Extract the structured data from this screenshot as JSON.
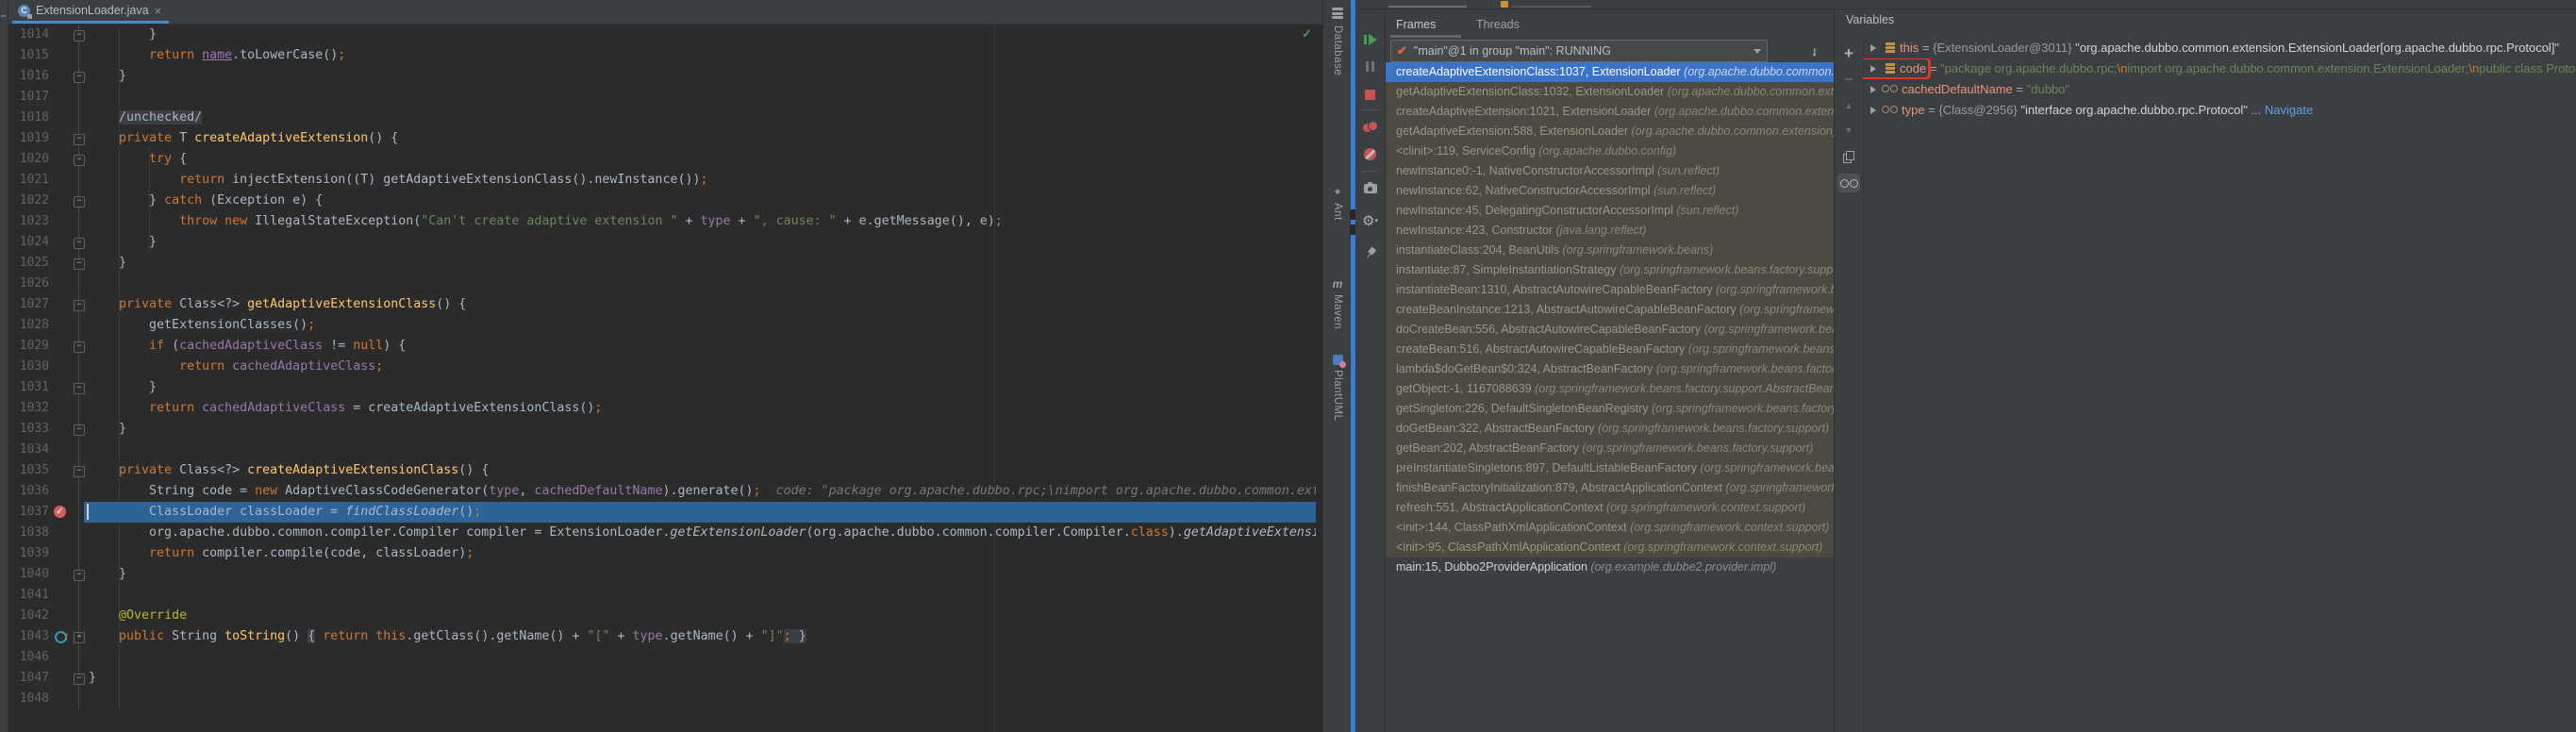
{
  "colors": {
    "editor_bg": "#2B2B2B",
    "panel_bg": "#3C3F41",
    "accent_tab_underline": "#4A88C7",
    "splitter_blue": "#3B7BD8",
    "exec_line_bg": "#2D6397",
    "selected_frame_bg": "#3B73C9",
    "library_frame_bg": "#4C4A41",
    "breakpoint_red": "#DB5C5C",
    "annotation_box_red": "#E3342B",
    "string_green": "#6A8759",
    "keyword_orange": "#CC7832",
    "field_purple": "#9876AA",
    "method_yellow": "#FFC66D",
    "link_blue": "#5F9EE8"
  },
  "editor": {
    "tab": {
      "title": "ExtensionLoader.java",
      "close_glyph": "×",
      "icon": "class-icon"
    },
    "inspection_status_glyph": "✓",
    "lines": [
      {
        "n": "1014",
        "g": "end",
        "t": [
          [
            "pl",
            "        }"
          ]
        ]
      },
      {
        "n": "1015",
        "t": [
          [
            "pl",
            "        "
          ],
          [
            "kw",
            "return"
          ],
          [
            "pl",
            " "
          ],
          [
            "fldu",
            "name"
          ],
          [
            "pl",
            ".toLowerCase()"
          ],
          [
            "sm",
            ";"
          ]
        ]
      },
      {
        "n": "1016",
        "g": "end",
        "t": [
          [
            "pl",
            "    }"
          ]
        ]
      },
      {
        "n": "1017",
        "t": []
      },
      {
        "n": "1018",
        "t": [
          [
            "pl",
            "    "
          ],
          [
            "fold",
            "/unchecked/"
          ]
        ]
      },
      {
        "n": "1019",
        "g": "open",
        "t": [
          [
            "pl",
            "    "
          ],
          [
            "kw",
            "private"
          ],
          [
            "pl",
            " T "
          ],
          [
            "fn",
            "createAdaptiveExtension"
          ],
          [
            "pl",
            "() {"
          ]
        ]
      },
      {
        "n": "1020",
        "g": "open",
        "t": [
          [
            "pl",
            "        "
          ],
          [
            "kw",
            "try"
          ],
          [
            "pl",
            " {"
          ]
        ]
      },
      {
        "n": "1021",
        "t": [
          [
            "pl",
            "            "
          ],
          [
            "kw",
            "return"
          ],
          [
            "pl",
            " injectExtension((T) getAdaptiveExtensionClass().newInstance())"
          ],
          [
            "sm",
            ";"
          ]
        ]
      },
      {
        "n": "1022",
        "g": "end",
        "t": [
          [
            "pl",
            "        } "
          ],
          [
            "kw",
            "catch"
          ],
          [
            "pl",
            " (Exception e) {"
          ]
        ]
      },
      {
        "n": "1023",
        "t": [
          [
            "pl",
            "            "
          ],
          [
            "kw",
            "throw"
          ],
          [
            "pl",
            " "
          ],
          [
            "kw",
            "new"
          ],
          [
            "pl",
            " IllegalStateException("
          ],
          [
            "st",
            "\"Can't create adaptive extension \""
          ],
          [
            "pl",
            " + "
          ],
          [
            "fld",
            "type"
          ],
          [
            "pl",
            " + "
          ],
          [
            "st",
            "\", cause: \""
          ],
          [
            "pl",
            " + e.getMessage(), e)"
          ],
          [
            "sm",
            ";"
          ]
        ]
      },
      {
        "n": "1024",
        "g": "end",
        "t": [
          [
            "pl",
            "        }"
          ]
        ]
      },
      {
        "n": "1025",
        "g": "end",
        "t": [
          [
            "pl",
            "    }"
          ]
        ]
      },
      {
        "n": "1026",
        "t": []
      },
      {
        "n": "1027",
        "g": "open",
        "t": [
          [
            "pl",
            "    "
          ],
          [
            "kw",
            "private"
          ],
          [
            "pl",
            " Class<?> "
          ],
          [
            "fn",
            "getAdaptiveExtensionClass"
          ],
          [
            "pl",
            "() {"
          ]
        ]
      },
      {
        "n": "1028",
        "t": [
          [
            "pl",
            "        getExtensionClasses()"
          ],
          [
            "sm",
            ";"
          ]
        ]
      },
      {
        "n": "1029",
        "g": "open",
        "t": [
          [
            "pl",
            "        "
          ],
          [
            "kw",
            "if"
          ],
          [
            "pl",
            " ("
          ],
          [
            "fld",
            "cachedAdaptiveClass"
          ],
          [
            "pl",
            " != "
          ],
          [
            "kw",
            "null"
          ],
          [
            "pl",
            ") {"
          ]
        ]
      },
      {
        "n": "1030",
        "t": [
          [
            "pl",
            "            "
          ],
          [
            "kw",
            "return"
          ],
          [
            "pl",
            " "
          ],
          [
            "fld",
            "cachedAdaptiveClass"
          ],
          [
            "sm",
            ";"
          ]
        ]
      },
      {
        "n": "1031",
        "g": "end",
        "t": [
          [
            "pl",
            "        }"
          ]
        ]
      },
      {
        "n": "1032",
        "t": [
          [
            "pl",
            "        "
          ],
          [
            "kw",
            "return"
          ],
          [
            "pl",
            " "
          ],
          [
            "fld",
            "cachedAdaptiveClass"
          ],
          [
            "pl",
            " = createAdaptiveExtensionClass()"
          ],
          [
            "sm",
            ";"
          ]
        ]
      },
      {
        "n": "1033",
        "g": "end",
        "t": [
          [
            "pl",
            "    }"
          ]
        ]
      },
      {
        "n": "1034",
        "t": []
      },
      {
        "n": "1035",
        "g": "open",
        "t": [
          [
            "pl",
            "    "
          ],
          [
            "kw",
            "private"
          ],
          [
            "pl",
            " Class<?> "
          ],
          [
            "fn",
            "createAdaptiveExtensionClass"
          ],
          [
            "pl",
            "() {"
          ]
        ]
      },
      {
        "n": "1036",
        "t": [
          [
            "pl",
            "        String code = "
          ],
          [
            "kw",
            "new"
          ],
          [
            "pl",
            " AdaptiveClassCodeGenerator("
          ],
          [
            "fld",
            "type"
          ],
          [
            "pl",
            ", "
          ],
          [
            "fld",
            "cachedDefaultName"
          ],
          [
            "pl",
            ").generate()"
          ],
          [
            "sm",
            ";"
          ],
          [
            "hint",
            "  code: \"package org.apache.dubbo.rpc;\\nimport org.apache.dubbo.common.exte"
          ]
        ]
      },
      {
        "n": "1037",
        "exec": true,
        "bp": true,
        "t": [
          [
            "pl",
            "        ClassLoader classLoader = "
          ],
          [
            "stm",
            "findClassLoader"
          ],
          [
            "pl",
            "()"
          ],
          [
            "sm",
            ";"
          ]
        ]
      },
      {
        "n": "1038",
        "t": [
          [
            "pl",
            "        org.apache.dubbo.common.compiler.Compiler compiler = ExtensionLoader."
          ],
          [
            "stm",
            "getExtensionLoader"
          ],
          [
            "pl",
            "(org.apache.dubbo.common.compiler.Compiler."
          ],
          [
            "kw",
            "class"
          ],
          [
            "pl",
            ")."
          ],
          [
            "stm",
            "getAdaptiveExtensio"
          ]
        ]
      },
      {
        "n": "1039",
        "t": [
          [
            "pl",
            "        "
          ],
          [
            "kw",
            "return"
          ],
          [
            "pl",
            " compiler.compile(code, classLoader)"
          ],
          [
            "sm",
            ";"
          ]
        ]
      },
      {
        "n": "1040",
        "g": "end",
        "t": [
          [
            "pl",
            "    }"
          ]
        ]
      },
      {
        "n": "1041",
        "t": []
      },
      {
        "n": "1042",
        "t": [
          [
            "pl",
            "    "
          ],
          [
            "an",
            "@Override"
          ]
        ]
      },
      {
        "n": "1043",
        "g": "plus",
        "ovr": true,
        "t": [
          [
            "pl",
            "    "
          ],
          [
            "kw",
            "public"
          ],
          [
            "pl",
            " String "
          ],
          [
            "fn",
            "toString"
          ],
          [
            "pl",
            "() "
          ],
          [
            "plf",
            "{"
          ],
          [
            "pl",
            " "
          ],
          [
            "kw",
            "return"
          ],
          [
            "pl",
            " "
          ],
          [
            "kw",
            "this"
          ],
          [
            "pl",
            ".getClass().getName() + "
          ],
          [
            "st",
            "\"[\""
          ],
          [
            "pl",
            " + "
          ],
          [
            "fld",
            "type"
          ],
          [
            "pl",
            ".getName() + "
          ],
          [
            "st",
            "\"]\""
          ],
          [
            "smf",
            ";"
          ],
          [
            "plf",
            " }"
          ]
        ]
      },
      {
        "n": "1046",
        "t": []
      },
      {
        "n": "1047",
        "g": "end",
        "t": [
          [
            "pl",
            "}"
          ]
        ]
      },
      {
        "n": "1048",
        "t": []
      }
    ]
  },
  "right_stripe": {
    "items": [
      {
        "icon": "database-icon",
        "label": "Database"
      },
      {
        "icon": "ant-icon",
        "label": "Ant"
      },
      {
        "icon": "maven-icon",
        "label": "Maven"
      },
      {
        "icon": "plantuml-icon",
        "label": "PlantUML"
      }
    ]
  },
  "debug": {
    "toolbar": [
      "resume",
      "pause",
      "stop",
      "view-breakpoints",
      "mute-breakpoints",
      "camera",
      "settings",
      "pin"
    ],
    "tabs": [
      {
        "label": "Frames"
      },
      {
        "label": "Threads"
      }
    ],
    "thread": {
      "check_glyph": "✔",
      "label": "\"main\"@1 in group \"main\": RUNNING"
    },
    "frames": [
      {
        "sig": "createAdaptiveExtensionClass:1037, ExtensionLoader",
        "pkg": "(org.apache.dubbo.common.extension)",
        "style": "sel"
      },
      {
        "sig": "getAdaptiveExtensionClass:1032, ExtensionLoader",
        "pkg": "(org.apache.dubbo.common.extension)",
        "style": "lib"
      },
      {
        "sig": "createAdaptiveExtension:1021, ExtensionLoader",
        "pkg": "(org.apache.dubbo.common.extension)",
        "style": "lib"
      },
      {
        "sig": "getAdaptiveExtension:588, ExtensionLoader",
        "pkg": "(org.apache.dubbo.common.extension)",
        "style": "lib"
      },
      {
        "sig": "<clinit>:119, ServiceConfig",
        "pkg": "(org.apache.dubbo.config)",
        "style": "lib"
      },
      {
        "sig": "newInstance0:-1, NativeConstructorAccessorImpl",
        "pkg": "(sun.reflect)",
        "style": "lib"
      },
      {
        "sig": "newInstance:62, NativeConstructorAccessorImpl",
        "pkg": "(sun.reflect)",
        "style": "lib"
      },
      {
        "sig": "newInstance:45, DelegatingConstructorAccessorImpl",
        "pkg": "(sun.reflect)",
        "style": "lib"
      },
      {
        "sig": "newInstance:423, Constructor",
        "pkg": "(java.lang.reflect)",
        "style": "lib"
      },
      {
        "sig": "instantiateClass:204, BeanUtils",
        "pkg": "(org.springframework.beans)",
        "style": "lib"
      },
      {
        "sig": "instantiate:87, SimpleInstantiationStrategy",
        "pkg": "(org.springframework.beans.factory.support)",
        "style": "lib"
      },
      {
        "sig": "instantiateBean:1310, AbstractAutowireCapableBeanFactory",
        "pkg": "(org.springframework.beans.factory.support)",
        "style": "lib"
      },
      {
        "sig": "createBeanInstance:1213, AbstractAutowireCapableBeanFactory",
        "pkg": "(org.springframework.beans.factory.support)",
        "style": "lib"
      },
      {
        "sig": "doCreateBean:556, AbstractAutowireCapableBeanFactory",
        "pkg": "(org.springframework.beans.factory.support)",
        "style": "lib"
      },
      {
        "sig": "createBean:516, AbstractAutowireCapableBeanFactory",
        "pkg": "(org.springframework.beans.factory.support)",
        "style": "lib"
      },
      {
        "sig": "lambda$doGetBean$0:324, AbstractBeanFactory",
        "pkg": "(org.springframework.beans.factory.support)",
        "style": "lib"
      },
      {
        "sig": "getObject:-1, 1167088639",
        "pkg": "(org.springframework.beans.factory.support.AbstractBeanFactory)",
        "style": "lib"
      },
      {
        "sig": "getSingleton:226, DefaultSingletonBeanRegistry",
        "pkg": "(org.springframework.beans.factory.support)",
        "style": "lib"
      },
      {
        "sig": "doGetBean:322, AbstractBeanFactory",
        "pkg": "(org.springframework.beans.factory.support)",
        "style": "lib"
      },
      {
        "sig": "getBean:202, AbstractBeanFactory",
        "pkg": "(org.springframework.beans.factory.support)",
        "style": "lib"
      },
      {
        "sig": "preInstantiateSingletons:897, DefaultListableBeanFactory",
        "pkg": "(org.springframework.beans.factory.support)",
        "style": "lib"
      },
      {
        "sig": "finishBeanFactoryInitialization:879, AbstractApplicationContext",
        "pkg": "(org.springframework.context.support)",
        "style": "lib"
      },
      {
        "sig": "refresh:551, AbstractApplicationContext",
        "pkg": "(org.springframework.context.support)",
        "style": "lib"
      },
      {
        "sig": "<init>:144, ClassPathXmlApplicationContext",
        "pkg": "(org.springframework.context.support)",
        "style": "lib"
      },
      {
        "sig": "<init>:95, ClassPathXmlApplicationContext",
        "pkg": "(org.springframework.context.support)",
        "style": "lib"
      },
      {
        "sig": "main:15, Dubbo2ProviderApplication",
        "pkg": "(org.example.dubbe2.provider.impl)",
        "style": "proj"
      }
    ],
    "variables": {
      "title": "Variables",
      "watch_toolbar": [
        "add-watch",
        "remove-watch",
        "move-up",
        "move-down",
        "duplicate-watch",
        "show-watches"
      ],
      "items": [
        {
          "icon": "bars",
          "name": "this",
          "segs": [
            [
              "eq",
              " = "
            ],
            [
              "ref",
              "{ExtensionLoader@3011} "
            ],
            [
              "obj",
              "\"org.apache.dubbo.common.extension.ExtensionLoader[org.apache.dubbo.rpc.Protocol]\""
            ]
          ]
        },
        {
          "icon": "bars",
          "name": "code",
          "boxed": true,
          "segs": [
            [
              "eq",
              " = "
            ],
            [
              "st",
              "\"package org.apache.dubbo.rpc;"
            ],
            [
              "esc",
              "\\n"
            ],
            [
              "st",
              "import org.apache.dubbo.common.extension.ExtensionLoader;"
            ],
            [
              "esc",
              "\\n"
            ],
            [
              "st",
              "public class Protocol$Adaptive"
            ]
          ]
        },
        {
          "icon": "oo",
          "name": "cachedDefaultName",
          "segs": [
            [
              "eq",
              " = "
            ],
            [
              "st",
              "\"dubbo\""
            ]
          ]
        },
        {
          "icon": "oo",
          "name": "type",
          "segs": [
            [
              "eq",
              " = "
            ],
            [
              "ref",
              "{Class@2956} "
            ],
            [
              "obj",
              "\"interface org.apache.dubbo.rpc.Protocol\""
            ],
            [
              "eq",
              " ... "
            ],
            [
              "link",
              "Navigate"
            ]
          ]
        }
      ]
    }
  }
}
